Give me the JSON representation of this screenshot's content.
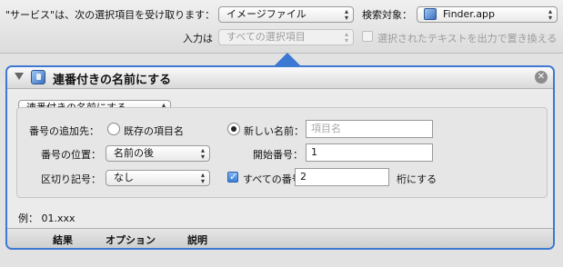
{
  "service_bar": {
    "receives_label": "\"サービス\"は、次の選択項目を受け取ります：",
    "input_type": "イメージファイル",
    "search_label": "検索対象：",
    "search_target": "Finder.app",
    "input_label": "入力は",
    "input_value": "すべての選択項目",
    "replace_label": "選択されたテキストを出力で置き換える"
  },
  "action": {
    "title": "連番付きの名前にする",
    "mode": "連番付きの名前にする",
    "add_number_to_label": "番号の追加先：",
    "existing_name_label": "既存の項目名",
    "new_name_label": "新しい名前：",
    "new_name_placeholder": "項目名",
    "position_label": "番号の位置：",
    "position_value": "名前の後",
    "start_number_label": "開始番号：",
    "start_number_value": "1",
    "separator_label": "区切り記号：",
    "separator_value": "なし",
    "all_numbers_label": "すべての番号を",
    "digits_value": "2",
    "digits_suffix": "桁にする",
    "example": "例： 01.xxx"
  },
  "footer_tabs": [
    "結果",
    "オプション",
    "説明"
  ]
}
